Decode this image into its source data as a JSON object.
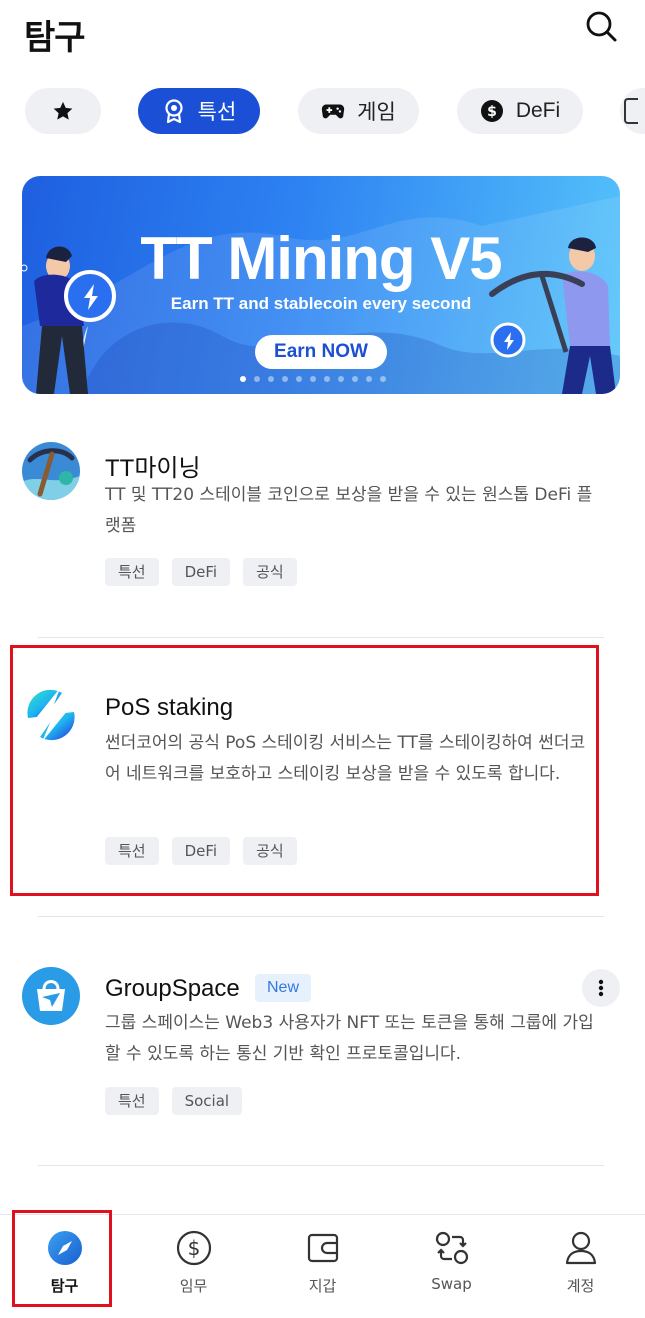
{
  "header": {
    "title": "탐구"
  },
  "chips": [
    {
      "label": "",
      "icon": "star-icon",
      "active": false
    },
    {
      "label": "특선",
      "icon": "award-icon",
      "active": true
    },
    {
      "label": "게임",
      "icon": "gamepad-icon",
      "active": false
    },
    {
      "label": "DeFi",
      "icon": "dollar-coin-icon",
      "active": false
    }
  ],
  "banner": {
    "headline": "TT Mining V5",
    "subtitle": "Earn TT and stablecoin every second",
    "cta": "Earn NOW",
    "slide_count": 11,
    "active_slide": 1
  },
  "items": [
    {
      "name": "TT마이닝",
      "description": "TT 및 TT20 스테이블 코인으로 보상을 받을 수 있는 원스톱 DeFi 플랫폼",
      "tags": [
        "특선",
        "DeFi",
        "공식"
      ],
      "icon": "pickaxe-icon"
    },
    {
      "name": "PoS staking",
      "description": "썬더코어의 공식 PoS 스테이킹 서비스는 TT를 스테이킹하여 썬더코어 네트워크를 보호하고 스테이킹 보상을 받을 수 있도록 합니다.",
      "tags": [
        "특선",
        "DeFi",
        "공식"
      ],
      "icon": "lightning-icon"
    },
    {
      "name": "GroupSpace",
      "badge": "New",
      "description": "그룹 스페이스는 Web3 사용자가 NFT 또는 토큰을 통해 그룹에 가입할 수 있도록 하는 통신 기반 확인 프로토콜입니다.",
      "tags": [
        "특선",
        "Social"
      ],
      "icon": "paper-plane-bag-icon"
    }
  ],
  "tabbar": {
    "tabs": [
      {
        "label": "탐구",
        "icon": "compass-icon",
        "active": true
      },
      {
        "label": "임무",
        "icon": "dollar-circle-icon",
        "active": false
      },
      {
        "label": "지갑",
        "icon": "wallet-icon",
        "active": false
      },
      {
        "label": "Swap",
        "icon": "swap-icon",
        "active": false
      },
      {
        "label": "계정",
        "icon": "user-icon",
        "active": false
      }
    ]
  },
  "colors": {
    "accent": "#1a4fd6",
    "highlight": "#e0101e",
    "chip_bg": "#eef0f3",
    "tab_active": "#1f6fd8"
  }
}
